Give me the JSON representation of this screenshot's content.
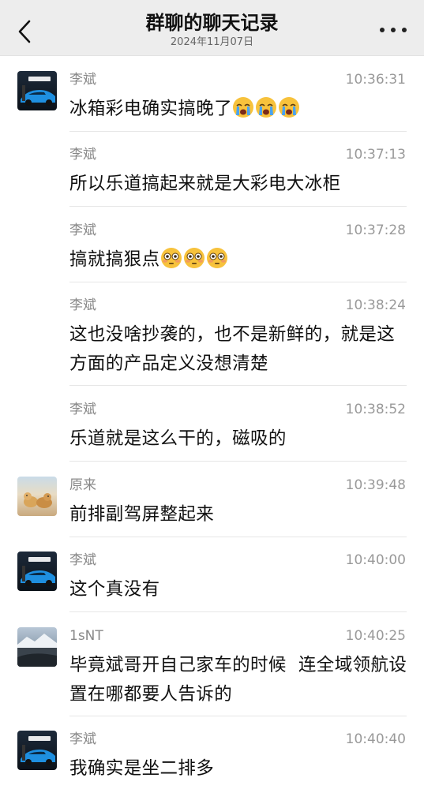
{
  "header": {
    "title": "群聊的聊天记录",
    "date": "2024年11月07日"
  },
  "messages": [
    {
      "sender": "李斌",
      "time": "10:36:31",
      "text": "冰箱彩电确实搞晚了",
      "emoji": [
        "crying-face",
        "crying-face",
        "crying-face"
      ],
      "avatar": "car-photo-avatar"
    },
    {
      "sender": "李斌",
      "time": "10:37:13",
      "text": "所以乐道搞起来就是大彩电大冰柜"
    },
    {
      "sender": "李斌",
      "time": "10:37:28",
      "text": "搞就搞狠点",
      "emoji": [
        "flushed-face",
        "flushed-face",
        "flushed-face"
      ]
    },
    {
      "sender": "李斌",
      "time": "10:38:24",
      "text": "这也没啥抄袭的，也不是新鲜的，就是这方面的产品定义没想清楚"
    },
    {
      "sender": "李斌",
      "time": "10:38:52",
      "text": "乐道就是这么干的，磁吸的"
    },
    {
      "sender": "原来",
      "time": "10:39:48",
      "text": "前排副驾屏整起来",
      "avatar": "dogs-photo-avatar"
    },
    {
      "sender": "李斌",
      "time": "10:40:00",
      "text": "这个真没有",
      "avatar": "car-photo-avatar"
    },
    {
      "sender": "1sNT",
      "time": "10:40:25",
      "text": "毕竟斌哥开自己家车的时候  连全域领航设置在哪都要人告诉的",
      "avatar": "mountain-photo-avatar"
    },
    {
      "sender": "李斌",
      "time": "10:40:40",
      "text": "我确实是坐二排多",
      "avatar": "car-photo-avatar"
    }
  ],
  "avatar_logo_text": "NIO EP9",
  "colors": {
    "header_bg": "#ededed",
    "name_gray": "#888888",
    "time_gray": "#999999",
    "text": "#111111",
    "divider": "#e6e6e6"
  }
}
